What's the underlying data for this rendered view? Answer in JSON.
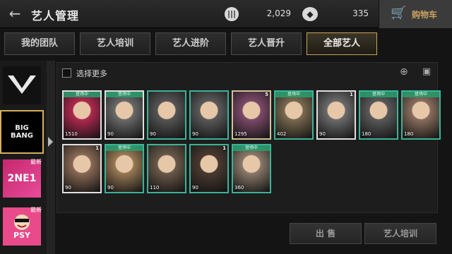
{
  "header": {
    "title": "艺人管理",
    "currency1": {
      "icon": "coin-icon",
      "value": "2,029"
    },
    "currency2": {
      "icon": "diamond-icon",
      "value": "335"
    },
    "cart_label": "购物车"
  },
  "tabs": [
    {
      "label": "我的团队",
      "active": false
    },
    {
      "label": "艺人培训",
      "active": false
    },
    {
      "label": "艺人进阶",
      "active": false
    },
    {
      "label": "艺人晋升",
      "active": false
    },
    {
      "label": "全部艺人",
      "active": true
    }
  ],
  "agencies": [
    {
      "name": "YG"
    },
    {
      "name": "BIG BANG",
      "selected": true
    },
    {
      "name": "2NE1",
      "badge": "最新"
    },
    {
      "name": "PSY",
      "badge": "最新"
    }
  ],
  "toolbar": {
    "select_more_label": "选择更多"
  },
  "cards": [
    {
      "tag": "登场中",
      "level": "1510",
      "stars": "",
      "frame": "white",
      "tone": "#b0294f"
    },
    {
      "tag": "登场中",
      "level": "90",
      "stars": "",
      "frame": "white",
      "tone": "#6a6a6a"
    },
    {
      "tag": "",
      "level": "90",
      "stars": "",
      "frame": "green",
      "tone": "#555"
    },
    {
      "tag": "",
      "level": "90",
      "stars": "",
      "frame": "green",
      "tone": "#5a5a5a"
    },
    {
      "tag": "",
      "level": "1295",
      "stars": "5",
      "frame": "gold",
      "tone": "#7d4a6a"
    },
    {
      "tag": "登场中",
      "level": "402",
      "stars": "",
      "frame": "green",
      "tone": "#7a6a50"
    },
    {
      "tag": "",
      "level": "90",
      "stars": "1",
      "frame": "white",
      "tone": "#6b6b6b"
    },
    {
      "tag": "登场中",
      "level": "180",
      "stars": "",
      "frame": "green",
      "tone": "#5a5a5a"
    },
    {
      "tag": "登场中",
      "level": "180",
      "stars": "",
      "frame": "green",
      "tone": "#8a6e5e"
    },
    {
      "tag": "",
      "level": "90",
      "stars": "1",
      "frame": "white",
      "tone": "#8a6a55"
    },
    {
      "tag": "登场中",
      "level": "90",
      "stars": "",
      "frame": "green",
      "tone": "#9a7a55"
    },
    {
      "tag": "",
      "level": "110",
      "stars": "",
      "frame": "green",
      "tone": "#6a5a4a"
    },
    {
      "tag": "",
      "level": "90",
      "stars": "1",
      "frame": "green",
      "tone": "#4a3a30"
    },
    {
      "tag": "登场中",
      "level": "360",
      "stars": "",
      "frame": "green",
      "tone": "#8a7a6a"
    }
  ],
  "buttons": {
    "sell": "出 售",
    "train": "艺人培训"
  }
}
